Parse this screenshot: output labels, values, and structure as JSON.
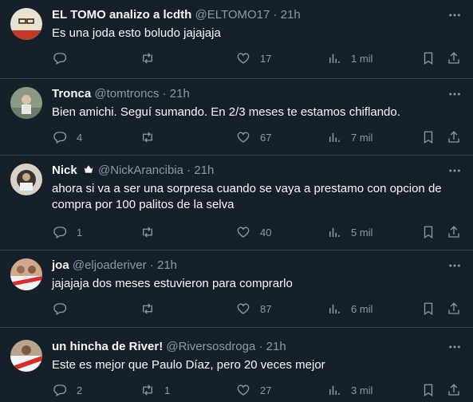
{
  "tweets": [
    {
      "name": "EL TOMO analizo a lcdth",
      "handle": "@ELTOMO17",
      "time": "21h",
      "text": "Es una joda esto boludo jajajaja",
      "replies": "",
      "retweets": "",
      "likes": "17",
      "views": "1 mil"
    },
    {
      "name": "Tronca",
      "handle": "@tomtroncs",
      "time": "21h",
      "text": "Bien amichi. Seguí sumando. En 2/3 meses te estamos chiflando.",
      "replies": "4",
      "retweets": "",
      "likes": "67",
      "views": "7 mil"
    },
    {
      "name": "Nick",
      "handle": "@NickArancibia",
      "time": "21h",
      "text": "ahora si va a ser una sorpresa cuando se vaya a prestamo con opcion de compra por 100 palitos de la selva",
      "replies": "1",
      "retweets": "",
      "likes": "40",
      "views": "5 mil"
    },
    {
      "name": "joa",
      "handle": "@eljoaderiver",
      "time": "21h",
      "text": "jajajaja dos meses estuvieron para comprarlo",
      "replies": "",
      "retweets": "",
      "likes": "87",
      "views": "6 mil"
    },
    {
      "name": "un hincha de River!",
      "handle": "@Riversosdroga",
      "time": "21h",
      "text": "Este es mejor que Paulo Díaz, pero 20 veces mejor",
      "replies": "2",
      "retweets": "1",
      "likes": "27",
      "views": "3 mil"
    }
  ],
  "separator": "·",
  "colors": {
    "background": "#15202b",
    "border": "#38444d",
    "primary_text": "#f7f9f9",
    "secondary_text": "#8b98a5"
  },
  "icons": [
    "reply-icon",
    "retweet-icon",
    "like-icon",
    "views-icon",
    "bookmark-icon",
    "share-icon",
    "more-icon",
    "verified-badge-icon"
  ]
}
